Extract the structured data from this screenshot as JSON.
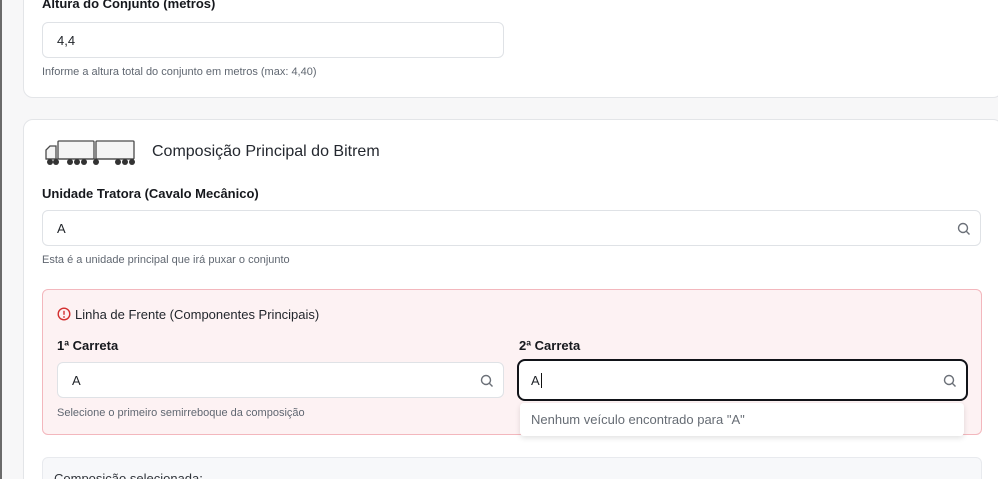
{
  "top_section": {
    "label": "Altura do Conjunto (metros)",
    "height_value": "4,4",
    "help": "Informe a altura total do conjunto em metros (max: 4,40)"
  },
  "main_section": {
    "title": "Composição Principal do Bitrem",
    "tractor": {
      "label": "Unidade Tratora (Cavalo Mecânico)",
      "value": "A",
      "help": "Esta é a unidade principal que irá puxar o conjunto"
    },
    "front_line": {
      "title": "Linha de Frente (Componentes Principais)",
      "trailer1": {
        "label": "1ª Carreta",
        "value": "A",
        "help": "Selecione o primeiro semirreboque da composição"
      },
      "trailer2": {
        "label": "2ª Carreta",
        "value": "A",
        "dropdown_empty": "Nenhum veículo encontrado para \"A\""
      }
    },
    "selected_label": "Composição selecionada:"
  },
  "colors": {
    "alert_bg": "#fdf2f3",
    "alert_border": "#f3b7bd",
    "alert_icon": "#d32f2f"
  }
}
